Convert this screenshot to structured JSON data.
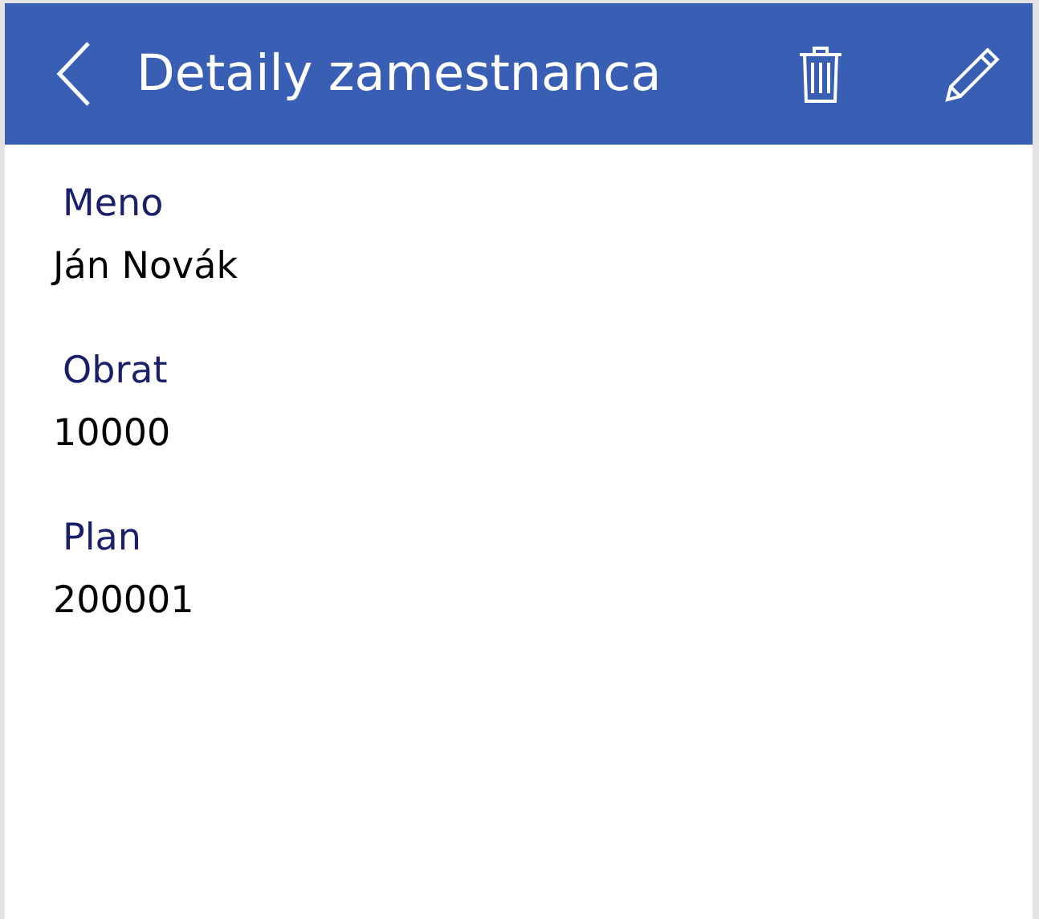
{
  "header": {
    "title": "Detaily zamestnanca"
  },
  "fields": [
    {
      "label": "Meno",
      "value": "Ján Novák"
    },
    {
      "label": "Obrat",
      "value": "10000"
    },
    {
      "label": "Plan",
      "value": "200001"
    }
  ]
}
